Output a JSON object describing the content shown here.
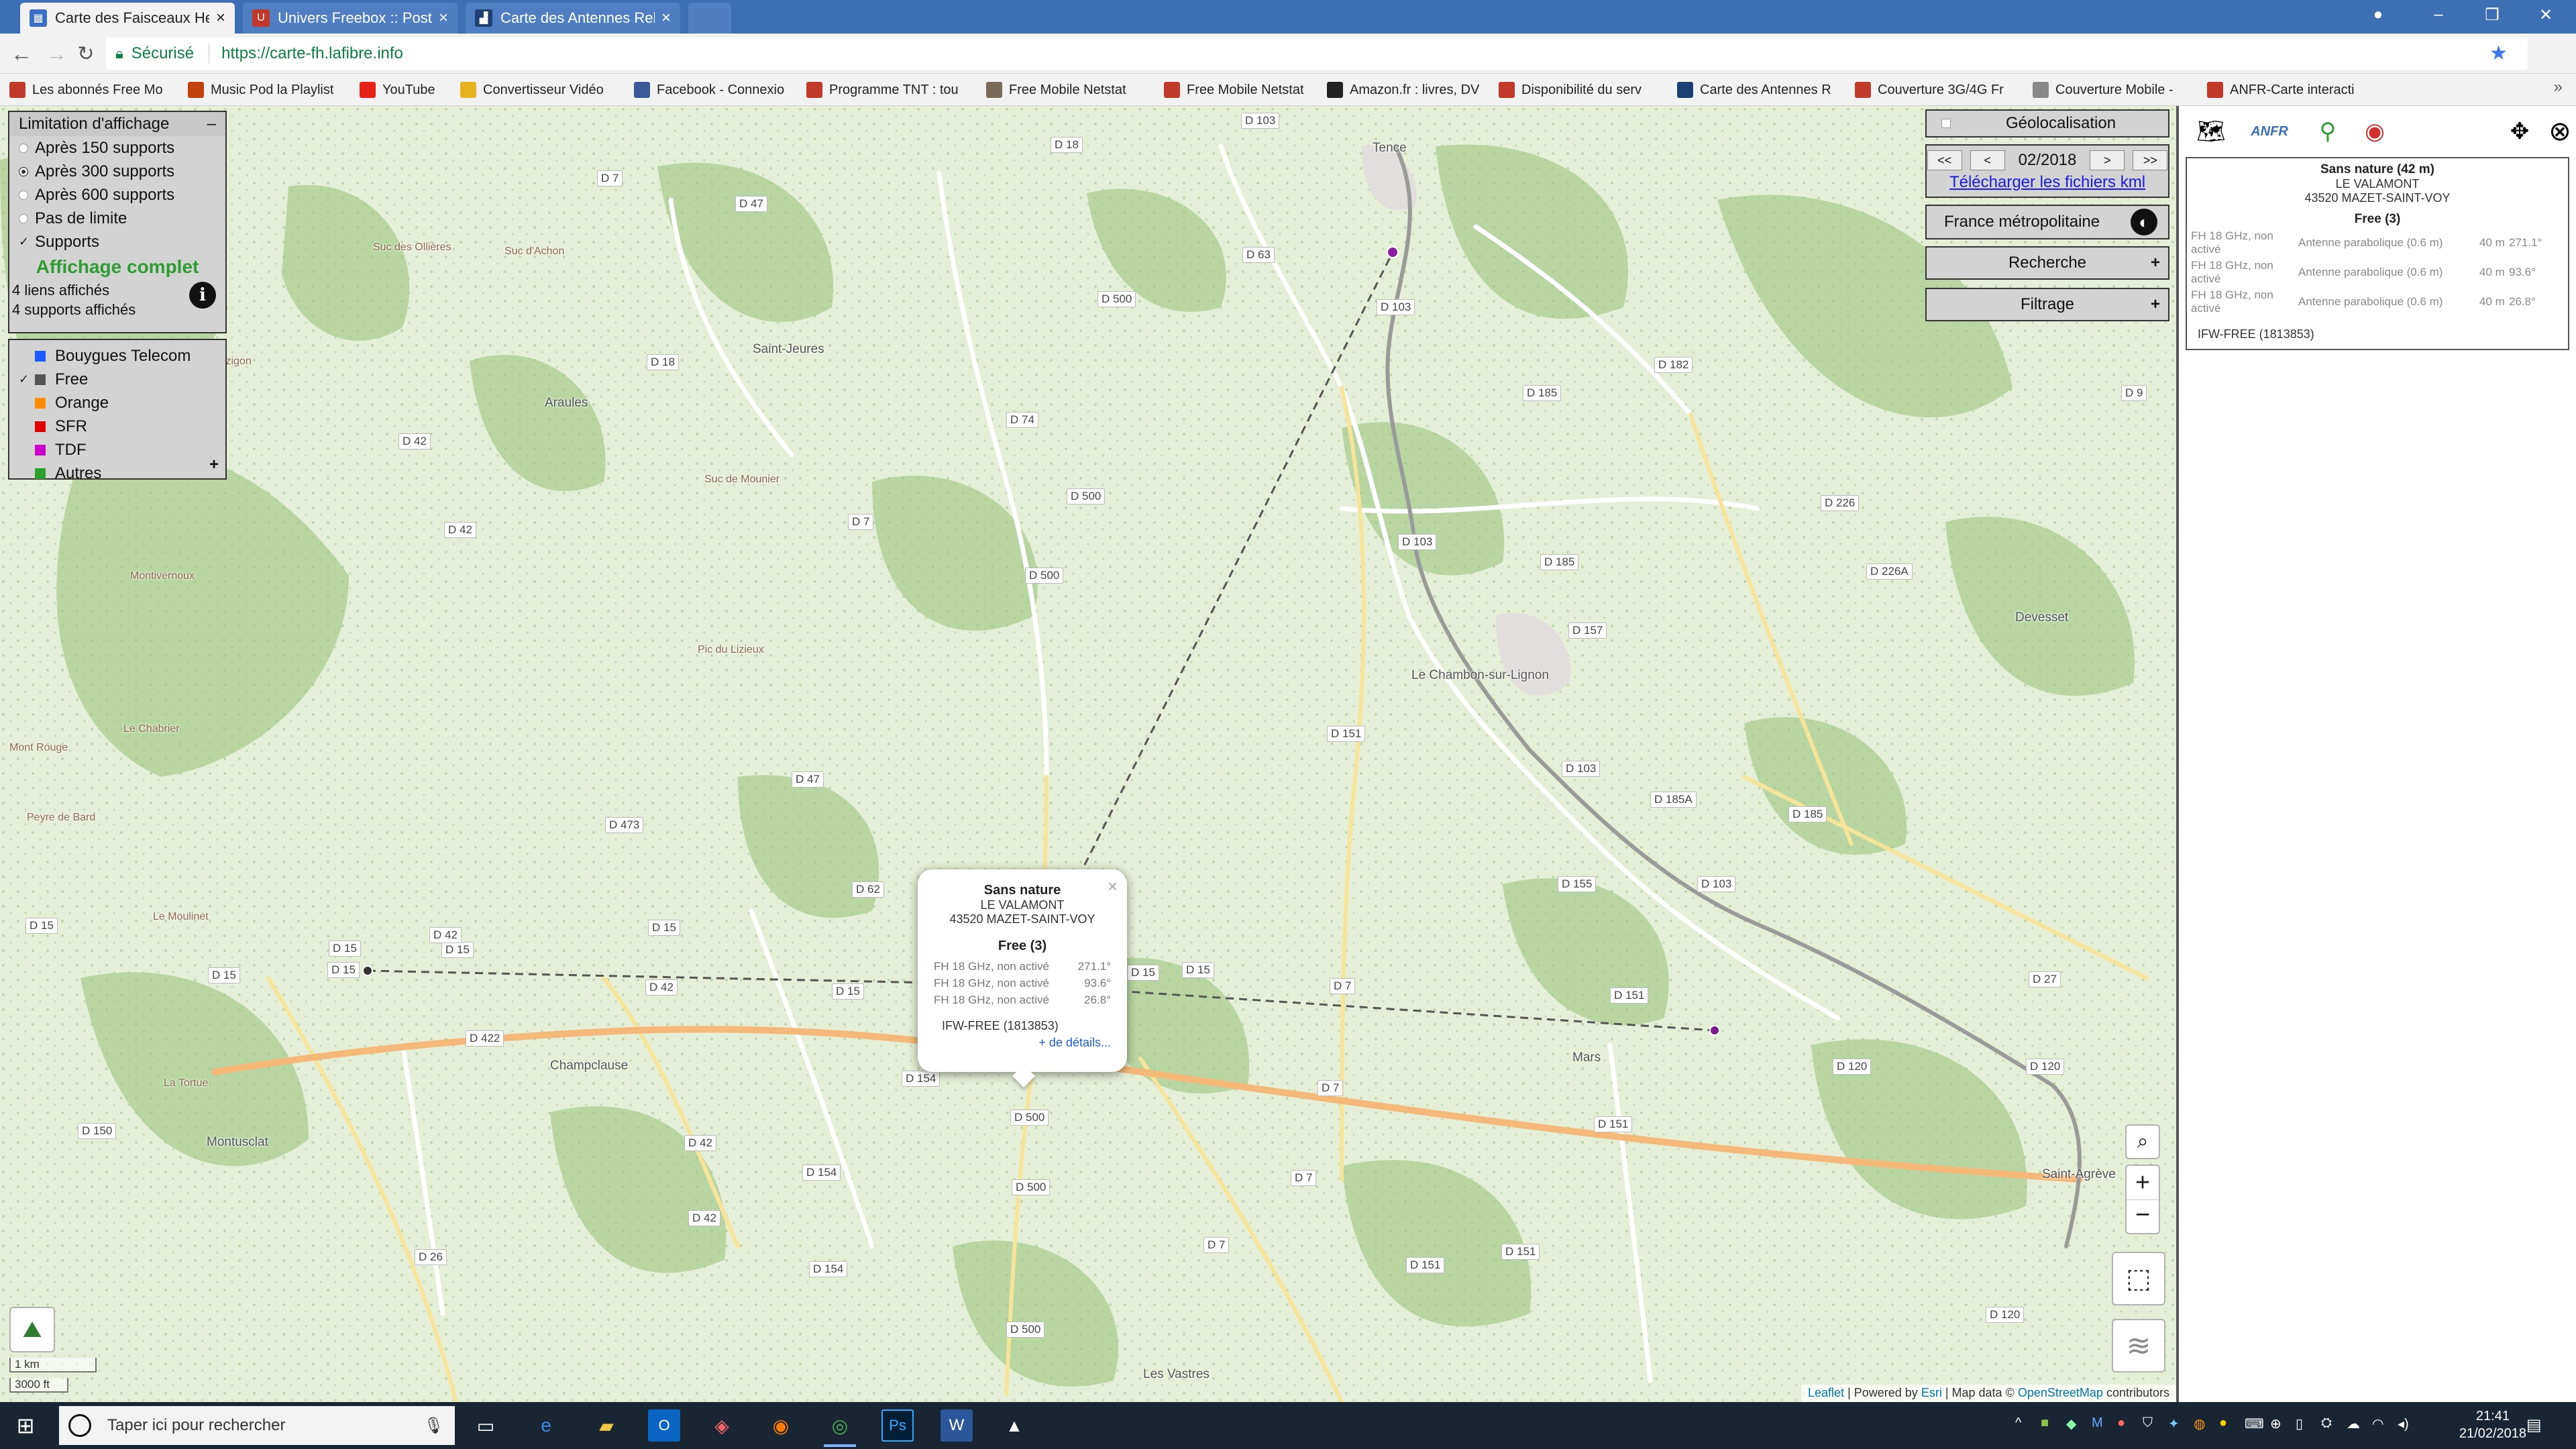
{
  "browser": {
    "tabs": [
      {
        "title": "Carte des Faisceaux Hert",
        "active": true,
        "icon_color": "#3b6fc1"
      },
      {
        "title": "Univers Freebox :: Poster",
        "active": false,
        "icon_color": "#c0392b"
      },
      {
        "title": "Carte des Antennes Rela",
        "active": false,
        "icon_color": "#1c3f74"
      }
    ],
    "secure_label": "Sécurisé",
    "url": "https://carte-fh.lafibre.info"
  },
  "bookmarks": [
    {
      "label": "Les abonnés Free Mo",
      "icon": "free-icon",
      "color": "#c0392b"
    },
    {
      "label": "Music Pod la Playlist",
      "icon": "music-icon",
      "color": "#c2410c"
    },
    {
      "label": "YouTube",
      "icon": "youtube-icon",
      "color": "#e62117"
    },
    {
      "label": "Convertisseur Vidéo",
      "icon": "folder-icon",
      "color": "#e6b220"
    },
    {
      "label": "Facebook - Connexio",
      "icon": "facebook-icon",
      "color": "#3b5998"
    },
    {
      "label": "Programme TNT : tou",
      "icon": "tnt-icon",
      "color": "#c0392b"
    },
    {
      "label": "Free Mobile Netstat",
      "icon": "person-icon",
      "color": "#7a6a5a"
    },
    {
      "label": "Free Mobile Netstat",
      "icon": "circle-icon",
      "color": "#c0392b"
    },
    {
      "label": "Amazon.fr : livres, DV",
      "icon": "amazon-icon",
      "color": "#222222"
    },
    {
      "label": "Disponibilité du serv",
      "icon": "f-icon",
      "color": "#c0392b"
    },
    {
      "label": "Carte des Antennes R",
      "icon": "chart-icon",
      "color": "#1c3f74"
    },
    {
      "label": "Couverture 3G/4G Fr",
      "icon": "signal-icon",
      "color": "#c0392b"
    },
    {
      "label": "Couverture Mobile -",
      "icon": "bars-icon",
      "color": "#888888"
    },
    {
      "label": "ANFR-Carte interacti",
      "icon": "anfr-icon",
      "color": "#c0392b"
    }
  ],
  "limitation_panel": {
    "title": "Limitation d'affichage",
    "collapse": "–",
    "options": [
      "Après 150 supports",
      "Après 300 supports",
      "Après 600 supports",
      "Pas de limite"
    ],
    "selected_index": 1,
    "supports_label": "Supports",
    "status": "Affichage complet",
    "links_count": "4 liens affichés",
    "supports_count": "4 supports affichés"
  },
  "operators": [
    {
      "name": "Bouygues Telecom",
      "color": "#1a5cff",
      "checked": false
    },
    {
      "name": "Free",
      "color": "#555555",
      "checked": true
    },
    {
      "name": "Orange",
      "color": "#ff8c00",
      "checked": false
    },
    {
      "name": "SFR",
      "color": "#e00000",
      "checked": false
    },
    {
      "name": "TDF",
      "color": "#cc00cc",
      "checked": false
    },
    {
      "name": "Autres",
      "color": "#2ea02e",
      "checked": false
    }
  ],
  "operators_expand": "+",
  "right_controls": {
    "geoloc": "Géolocalisation",
    "prev_prev": "<<",
    "prev": "<",
    "date": "02/2018",
    "next": ">",
    "next_next": ">>",
    "kml": "Télécharger les fichiers kml",
    "region": "France métropolitaine",
    "search": "Recherche",
    "filter": "Filtrage",
    "plus": "+"
  },
  "popup": {
    "title": "Sans nature",
    "line1": "LE VALAMONT",
    "line2": "43520 MAZET-SAINT-VOY",
    "operator": "Free (3)",
    "rows": [
      {
        "label": "FH 18 GHz, non activé",
        "azimuth": "271.1°"
      },
      {
        "label": "FH 18 GHz, non activé",
        "azimuth": "93.6°"
      },
      {
        "label": "FH 18 GHz, non activé",
        "azimuth": "26.8°"
      }
    ],
    "ref": "IFW-FREE (1813853)",
    "more": "+ de détails...",
    "close": "×"
  },
  "map": {
    "places": [
      {
        "name": "Tence"
      },
      {
        "name": "Saint-Jeures"
      },
      {
        "name": "Araules"
      },
      {
        "name": "Le Chambon-sur-Lignon"
      },
      {
        "name": "Devesset"
      },
      {
        "name": "Champclause"
      },
      {
        "name": "Montusclat"
      },
      {
        "name": "Mars"
      },
      {
        "name": "Saint-Agrève"
      },
      {
        "name": "Les Vastres"
      },
      {
        "name": "Suc des Ollières"
      },
      {
        "name": "Suc d'Achon"
      },
      {
        "name": "Le Mazigon"
      },
      {
        "name": "Suc de Mounier"
      },
      {
        "name": "Montivernoux"
      },
      {
        "name": "Pic du Lizieux"
      },
      {
        "name": "Le Chabrier"
      },
      {
        "name": "Mont Rouge"
      },
      {
        "name": "Peyre de Bard"
      },
      {
        "name": "Le Moulinet"
      },
      {
        "name": "La Tortue"
      }
    ],
    "roads": [
      "D 103",
      "D 18",
      "D 7",
      "D 47",
      "D 63",
      "D 500",
      "D 103",
      "D 185",
      "D 182",
      "D 9",
      "D 74",
      "D 42",
      "D 18",
      "D 500",
      "D 7",
      "D 226",
      "D 185",
      "D 226A",
      "D 157",
      "D 42",
      "D 47",
      "D 151",
      "D 103",
      "D 185A",
      "D 185",
      "D 15",
      "D 42",
      "D 15",
      "D 62",
      "D 15",
      "D 155",
      "D 103",
      "D 15",
      "D 27",
      "D 422",
      "D 500",
      "D 7",
      "D 151",
      "D 120",
      "D 120",
      "D 150",
      "D 154",
      "D 500",
      "D 42",
      "D 154",
      "D 7",
      "D 151",
      "D 26",
      "D 42",
      "D 154",
      "D 500",
      "D 7",
      "D 151",
      "D 151",
      "D 120",
      "D 500",
      "D 15",
      "D 15",
      "D 42",
      "D 15",
      "D 15",
      "D 15",
      "D 7",
      "D 473",
      "D 500",
      "D 103"
    ],
    "scale_km": "1 km",
    "scale_ft": "3000 ft",
    "attribution": {
      "leaflet": "Leaflet",
      "esri_pre": "Powered by",
      "esri": "Esri",
      "mid": "Map data ©",
      "osm": "OpenStreetMap",
      "end": "contributors"
    }
  },
  "info_pane": {
    "title": "Sans nature (42 m)",
    "line1": "LE VALAMONT",
    "line2": "43520 MAZET-SAINT-VOY",
    "operator": "Free (3)",
    "rows": [
      {
        "system": "FH 18 GHz, non activé",
        "antenna": "Antenne parabolique (0.6 m)",
        "height": "40 m",
        "azimuth": "271.1°"
      },
      {
        "system": "FH 18 GHz, non activé",
        "antenna": "Antenne parabolique (0.6 m)",
        "height": "40 m",
        "azimuth": "93.6°"
      },
      {
        "system": "FH 18 GHz, non activé",
        "antenna": "Antenne parabolique (0.6 m)",
        "height": "40 m",
        "azimuth": "26.8°"
      }
    ],
    "ref": "IFW-FREE (1813853)",
    "anfr": "ANFR"
  },
  "taskbar": {
    "search_placeholder": "Taper ici pour rechercher",
    "time": "21:41",
    "date": "21/02/2018"
  }
}
